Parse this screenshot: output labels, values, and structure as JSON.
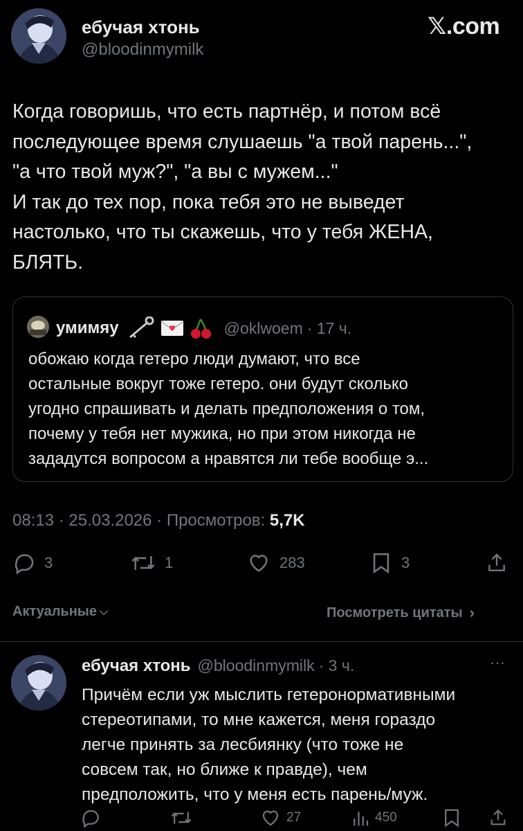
{
  "header": {
    "display_name": "ебучая хтонь",
    "handle": "@bloodinmymilk",
    "site_logo_x": "𝕏",
    "site_logo_domain": ".com"
  },
  "main_tweet": {
    "text": "Когда говоришь, что есть партнёр, и потом всё\nпоследующее время слушаешь \"а твой парень...\",\n\"а что твой муж?\", \"а вы с мужем...\"\nИ так до тех пор, пока тебя это не выведет\nнастолько, что ты скажешь, что у тебя ЖЕНА,\nБЛЯТЬ.",
    "timestamp": "08:13 · 25.03.2026 · Просмотров: ",
    "views": "5,7K",
    "replies": "3",
    "reposts": "1",
    "likes": "283",
    "bookmarks": "3"
  },
  "quoted_tweet": {
    "display_name": "умимяу",
    "emoji": "🗝 💌 🍒",
    "handle": "@oklwoem",
    "time": "· 17 ч.",
    "text": "обожаю когда гетеро люди думают, что все\nостальные вокруг тоже гетеро. они будут сколько\nугодно спрашивать и делать предположения о том,\nпочему у тебя нет мужика, но при этом никогда не\nзададутся вопросом а нравятся ли тебе вообще э..."
  },
  "filters": {
    "sort_label": "Актуальные",
    "sort_caret": "⌵",
    "quotes_link": "Посмотреть цитаты",
    "quotes_arrow": "›"
  },
  "reply": {
    "display_name": "ебучая хтонь",
    "handle": "@bloodinmymilk",
    "time": "· 3 ч.",
    "more": "···",
    "text": "Причём если уж мыслить гетеронормативными\nстереотипами, то мне кажется, меня гораздо\nлегче принять за лесбиянку (что тоже не\nсовсем так, но ближе к правде), чем\nпредположить, что у меня есть парень/муж.",
    "likes": "27",
    "views": "450"
  },
  "colors": {
    "background": "#000000",
    "text": "#e7e9ea",
    "muted": "#71767b",
    "border": "#2f3336",
    "cherry": "#d0172b"
  },
  "icons": [
    "avatar",
    "x-logo",
    "key-icon",
    "envelope-icon",
    "cherry-icon",
    "reply-icon",
    "repost-icon",
    "like-icon",
    "bookmark-icon",
    "share-icon",
    "views-icon",
    "more-icon",
    "chevron-down-icon",
    "chevron-right-icon"
  ]
}
